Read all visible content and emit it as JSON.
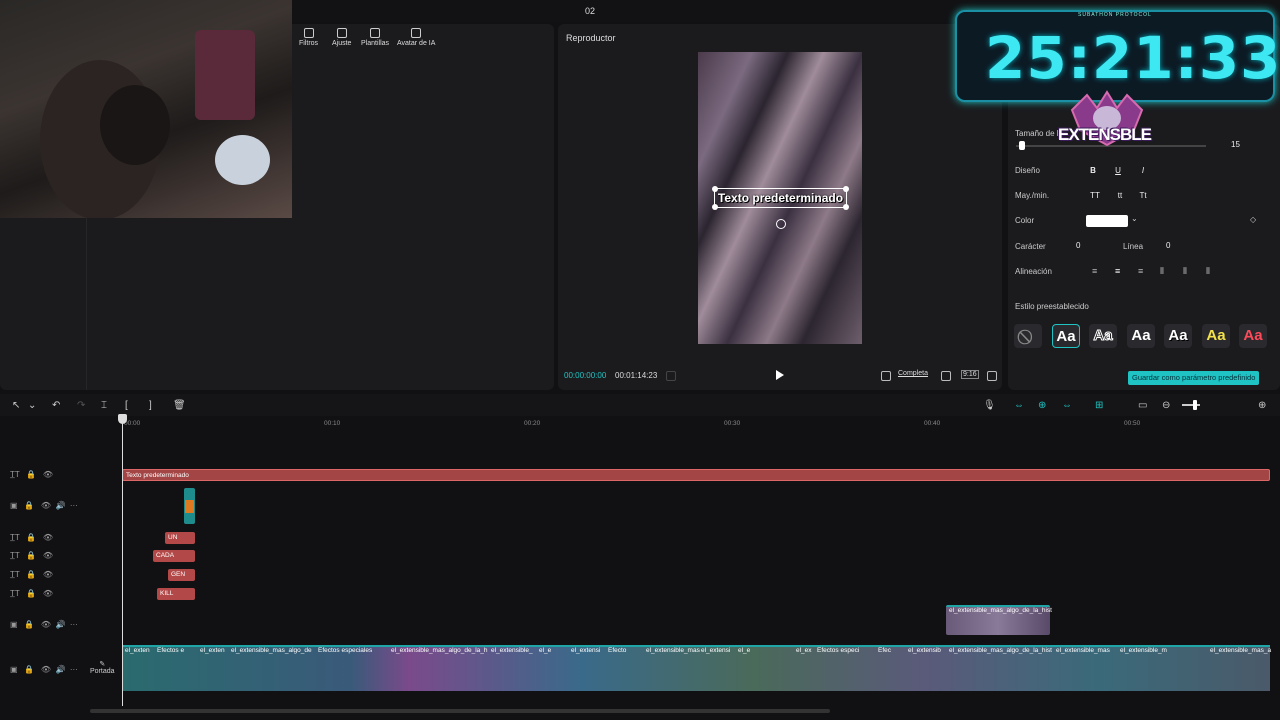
{
  "project": {
    "name": "02"
  },
  "tools": [
    {
      "label": "Filtros",
      "icon": "filter-icon"
    },
    {
      "label": "Ajuste",
      "icon": "sliders-icon"
    },
    {
      "label": "Plantillas",
      "icon": "template-icon"
    },
    {
      "label": "Avatar de IA",
      "icon": "avatar-icon"
    }
  ],
  "player": {
    "title": "Reproductor",
    "overlay_text": "Texto predeterminado",
    "current_time": "00:00:00:00",
    "total_time": "00:01:14:23",
    "view_mode": "Completa",
    "aspect": "9:16"
  },
  "properties": {
    "size_label": "Tamaño de la",
    "size_value": "15",
    "size_fraction": 0.03,
    "design_label": "Diseño",
    "design_buttons": [
      "B",
      "U",
      "I"
    ],
    "case_label": "May./min.",
    "case_buttons": [
      "TT",
      "tt",
      "Tt"
    ],
    "color_label": "Color",
    "color_value": "#ffffff",
    "char_label": "Carácter",
    "char_value": "0",
    "line_label": "Línea",
    "line_value": "0",
    "align_label": "Alineación",
    "preset_label": "Estilo preestablecido",
    "presets": [
      "Aa",
      "Aa",
      "Aa",
      "Aa",
      "Aa",
      "Aa"
    ],
    "save_preset": "Guardar como parámetro predefinido"
  },
  "overlay": {
    "timer": "25:21:33",
    "sub": "SUBATHON PROTOCOL",
    "brand": "EXTENSBLE"
  },
  "timeline": {
    "ticks": [
      "00:00",
      "00:10",
      "00:20",
      "00:30",
      "00:40",
      "00:50"
    ],
    "text_clip_main": "Texto predeterminado",
    "text_clips": [
      "UN",
      "CADA",
      "GEN",
      "KILL"
    ],
    "overlay_clip": "el_extensible_mas_algo_de_la_hist",
    "main_clips": [
      "el_exten",
      "Efectos e",
      "el_exten",
      "el_extensible_mas_algo_de",
      "Efectos especiales",
      "el_extensible_mas_algo_de_la_h",
      "el_extensible_",
      "el_e",
      "el_extensi",
      "Efecto",
      "el_extensible_mas",
      "el_extensi",
      "el_e",
      "el_ex",
      "Efectos especi",
      "Efec",
      "el_extensib",
      "el_extensible_mas_algo_de_la_hist",
      "el_extensible_mas",
      "el_extensible_m",
      "el_extensible_mas_a"
    ],
    "cover_label": "Portada"
  },
  "colors": {
    "accent": "#22c3c3",
    "text_clip": "#b34848",
    "timer": "#3de8f2"
  }
}
